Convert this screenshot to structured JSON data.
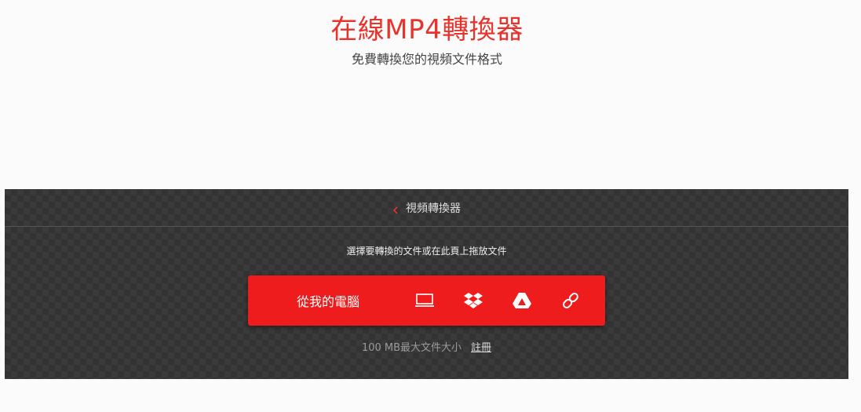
{
  "page": {
    "title": "在線MP4轉換器",
    "subtitle": "免費轉換您的視頻文件格式"
  },
  "panel": {
    "back_label": "視頻轉換器",
    "instruction": "選擇要轉換的文件或在此頁上拖放文件",
    "upload_label": "從我的電腦",
    "sources": [
      "computer-icon",
      "dropbox-icon",
      "google-drive-icon",
      "url-link-icon"
    ],
    "limit_text": "100 MB最大文件大小",
    "signup_label": "註冊"
  },
  "colors": {
    "accent": "#ee1c1c",
    "title": "#e8332c",
    "panel_bg": "#3a3a3a"
  }
}
